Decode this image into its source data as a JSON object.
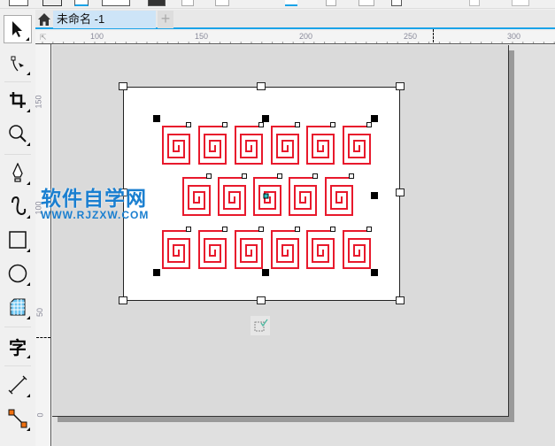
{
  "document_tab": {
    "title": "未命名 -1",
    "add_tab": "+"
  },
  "rulers": {
    "horizontal": [
      "100",
      "150",
      "200",
      "250",
      "300"
    ],
    "vertical": [
      "150",
      "100",
      "50",
      "0"
    ]
  },
  "tools": [
    {
      "name": "pick-tool"
    },
    {
      "name": "shape-tool"
    },
    {
      "name": "crop-tool"
    },
    {
      "name": "zoom-tool"
    },
    {
      "name": "pen-tool"
    },
    {
      "name": "artistic-media-tool"
    },
    {
      "name": "rectangle-tool"
    },
    {
      "name": "ellipse-tool"
    },
    {
      "name": "graph-paper-tool"
    },
    {
      "name": "text-tool",
      "glyph": "字"
    },
    {
      "name": "dimension-tool"
    },
    {
      "name": "connector-tool"
    }
  ],
  "watermark": {
    "title": "软件自学网",
    "url": "WWW.RJZXW.COM"
  },
  "colors": {
    "accent": "#1aa3e8",
    "spiral": "#e8192c",
    "watermark": "#1a7fd0"
  }
}
